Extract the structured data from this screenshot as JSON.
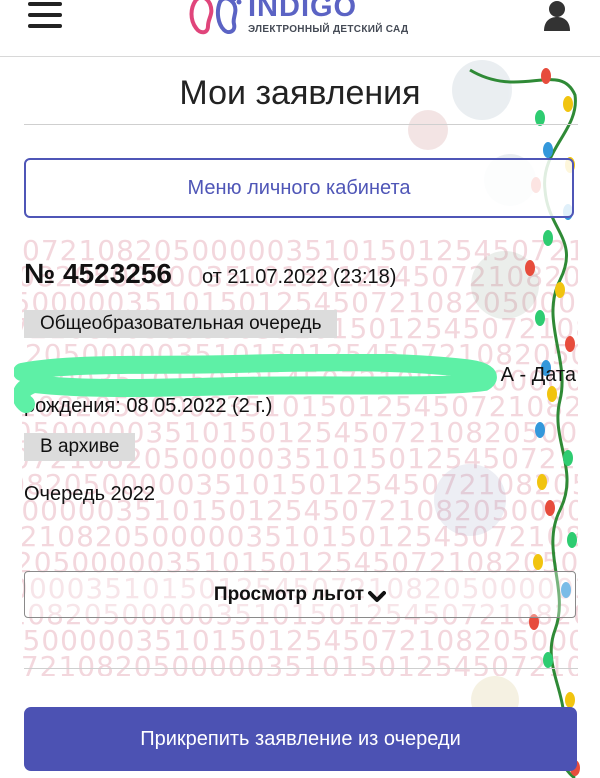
{
  "header": {
    "logo_title": "INDIGO",
    "logo_subtitle": "ЭЛЕКТРОННЫЙ ДЕТСКИЙ САД",
    "menu_icon": "hamburger-menu-icon",
    "user_icon": "user-profile-icon"
  },
  "page": {
    "title": "Мои заявления"
  },
  "cabinet_menu": {
    "label": "Меню личного кабинета"
  },
  "application": {
    "number": "№ 4523256",
    "date": "от 21.07.2022 (23:18)",
    "queue_type": "Общеобразовательная очередь",
    "child_line1": "А - Дата",
    "child_line2": "рождения: 08.05.2022 (2 г.)",
    "status": "В архиве",
    "queue_year": "Очередь 2022",
    "background_code": "072108205000003510150125450721082050000035101501254507210820500000351015012545"
  },
  "benefits": {
    "label": "Просмотр льгот",
    "chevron_icon": "chevron-down-icon"
  },
  "attach": {
    "label": "Прикрепить заявление из очереди"
  },
  "colors": {
    "accent": "#4f56b7",
    "button_fill": "#4c52b3",
    "badge_bg": "#dcdcdc",
    "redaction": "#5ef0a6",
    "watermark": "#f3d7dd"
  }
}
